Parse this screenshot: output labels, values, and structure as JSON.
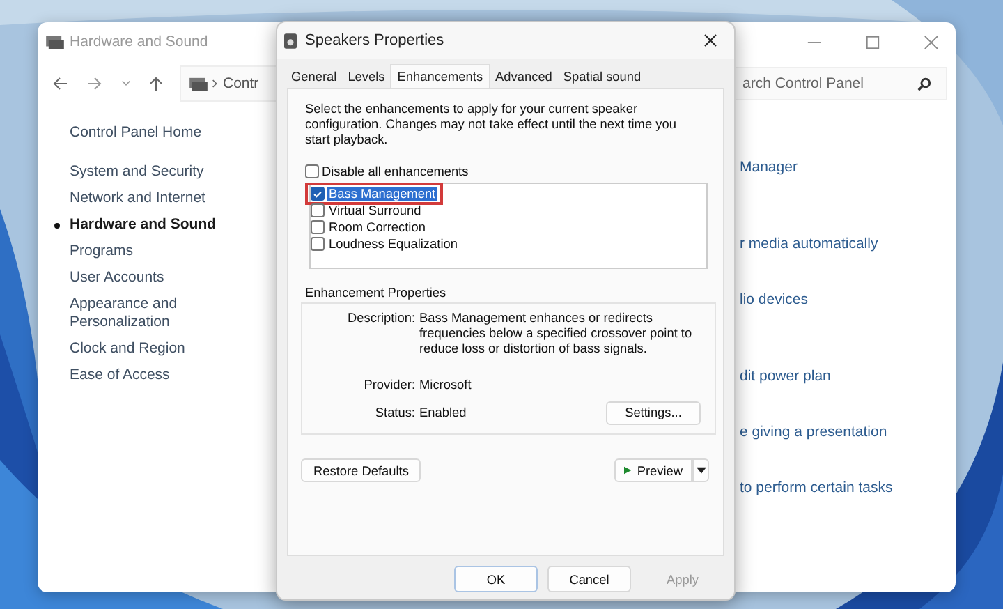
{
  "control_panel": {
    "title": "Hardware and Sound",
    "breadcrumb": "Contr",
    "search": {
      "placeholder": "arch Control Panel"
    },
    "sidebar": {
      "items": [
        {
          "label": "Control Panel Home",
          "selected": false
        },
        {
          "label": "System and Security",
          "selected": false
        },
        {
          "label": "Network and Internet",
          "selected": false
        },
        {
          "label": "Hardware and Sound",
          "selected": true
        },
        {
          "label": "Programs",
          "selected": false
        },
        {
          "label": "User Accounts",
          "selected": false
        },
        {
          "label": "Appearance and Personalization",
          "selected": false
        },
        {
          "label": "Clock and Region",
          "selected": false
        },
        {
          "label": "Ease of Access",
          "selected": false
        }
      ]
    },
    "links": [
      "Manager",
      "r media automatically",
      "lio devices",
      "dit power plan",
      "e giving a presentation",
      "to perform certain tasks"
    ]
  },
  "dialog": {
    "title": "Speakers Properties",
    "tabs": [
      {
        "label": "General",
        "selected": false
      },
      {
        "label": "Levels",
        "selected": false
      },
      {
        "label": "Enhancements",
        "selected": true
      },
      {
        "label": "Advanced",
        "selected": false
      },
      {
        "label": "Spatial sound",
        "selected": false
      }
    ],
    "intro": "Select the enhancements to apply for your current speaker configuration. Changes may not take effect until the next time you start playback.",
    "disable_all": {
      "label": "Disable all enhancements",
      "checked": false
    },
    "enhancements": [
      {
        "label": "Bass Management",
        "checked": true,
        "selected": true,
        "highlighted": true
      },
      {
        "label": "Virtual Surround",
        "checked": false,
        "selected": false,
        "highlighted": false
      },
      {
        "label": "Room Correction",
        "checked": false,
        "selected": false,
        "highlighted": false
      },
      {
        "label": "Loudness Equalization",
        "checked": false,
        "selected": false,
        "highlighted": false
      }
    ],
    "properties": {
      "heading": "Enhancement Properties",
      "description_label": "Description:",
      "description": "Bass Management enhances or redirects frequencies below a specified crossover point to reduce loss or distortion of bass signals.",
      "provider_label": "Provider:",
      "provider": "Microsoft",
      "status_label": "Status:",
      "status": "Enabled",
      "settings_button": "Settings..."
    },
    "restore_button": "Restore Defaults",
    "preview_button": "Preview",
    "buttons": [
      {
        "label": "OK",
        "disabled": false
      },
      {
        "label": "Cancel",
        "disabled": false
      },
      {
        "label": "Apply",
        "disabled": true
      }
    ]
  }
}
